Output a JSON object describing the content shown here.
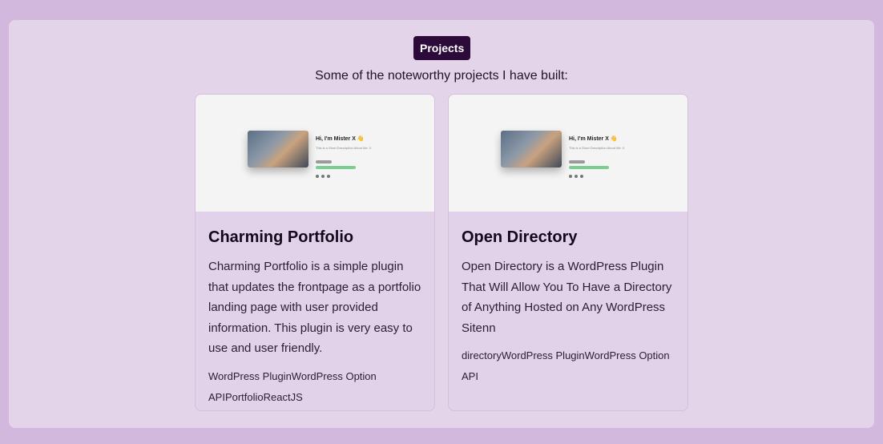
{
  "section": {
    "badge": "Projects",
    "subtitle": "Some of the noteworthy projects I have built:"
  },
  "projects": [
    {
      "title": "Charming Portfolio",
      "description": "Charming Portfolio is a simple plugin that updates the frontpage as a portfolio landing page with user provided information. This plugin is very easy to use and user friendly.",
      "tags": "WordPress PluginWordPress Option APIPortfolioReactJS",
      "thumbnail": {
        "heading": "Hi, I'm Mister X 👋",
        "subtext": "This is a Short Description About Me :X"
      }
    },
    {
      "title": "Open Directory",
      "description": "Open Directory is a WordPress Plugin That Will Allow You To Have a Directory of Anything Hosted on Any WordPress Sitenn",
      "tags": "directoryWordPress PluginWordPress Option API",
      "thumbnail": {
        "heading": "Hi, I'm Mister X 👋",
        "subtext": "This is a Short Description About Me :X"
      }
    }
  ],
  "colors": {
    "background": "#d1b8dc",
    "panel": "#e4d4ea",
    "badge": "#2c0b3b",
    "card": "#e2d2e9"
  }
}
